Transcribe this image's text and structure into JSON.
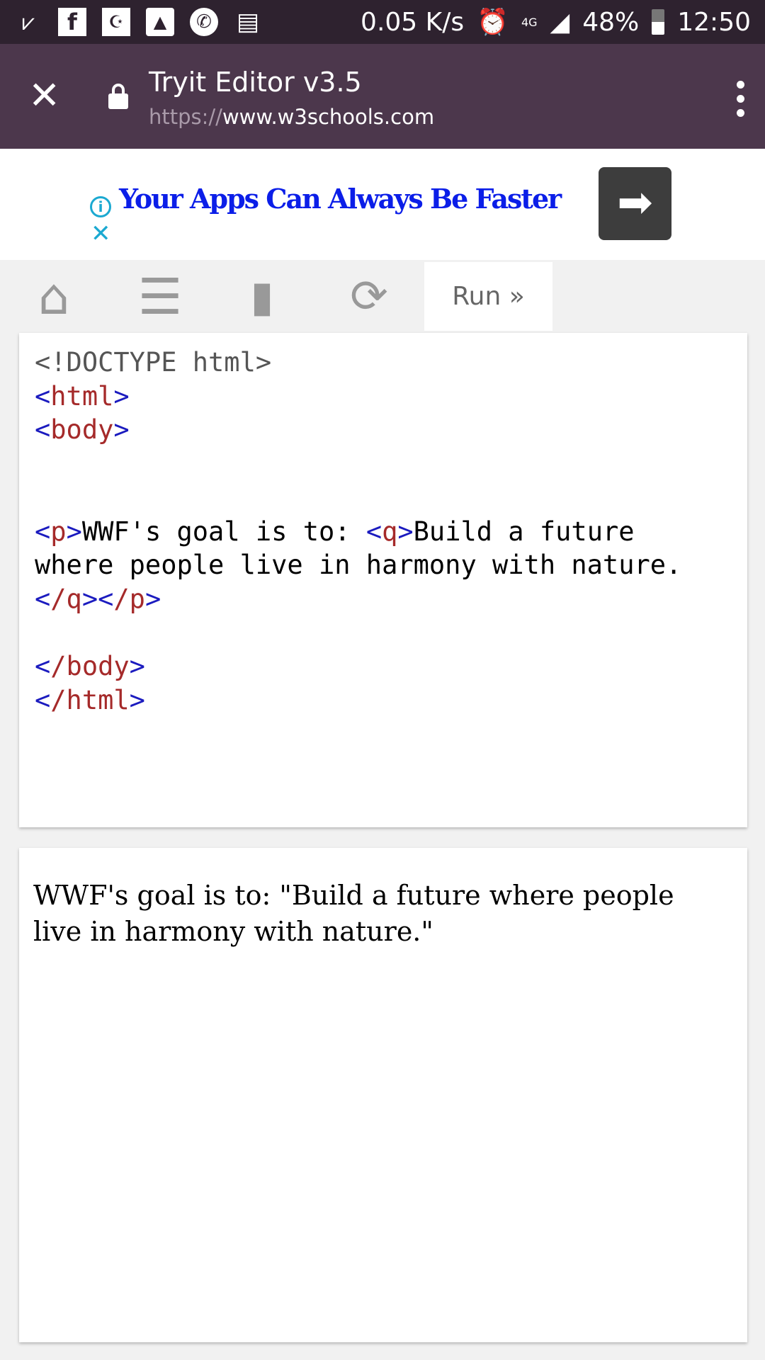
{
  "status_bar": {
    "net_speed": "0.05 K/s",
    "network": "4G",
    "battery": "48%",
    "time": "12:50"
  },
  "browser": {
    "title": "Tryit Editor v3.5",
    "url_scheme": "https://",
    "url_host": "www.w3schools.com"
  },
  "ad": {
    "headline": "Your Apps Can Always Be Faster"
  },
  "editor": {
    "run_label": "Run »",
    "code": {
      "doctype": "<!DOCTYPE html>",
      "html_open": "html",
      "body_open": "body",
      "p_tag": "p",
      "p_text": "WWF's goal is to: ",
      "q_tag": "q",
      "q_text": "Build a future\nwhere people live in harmony with nature.",
      "q_close": "/q",
      "p_close": "/p",
      "body_close": "/body",
      "html_close": "/html"
    }
  },
  "output": {
    "text": "WWF's goal is to: \"Build a future where people live in harmony with nature.\""
  }
}
